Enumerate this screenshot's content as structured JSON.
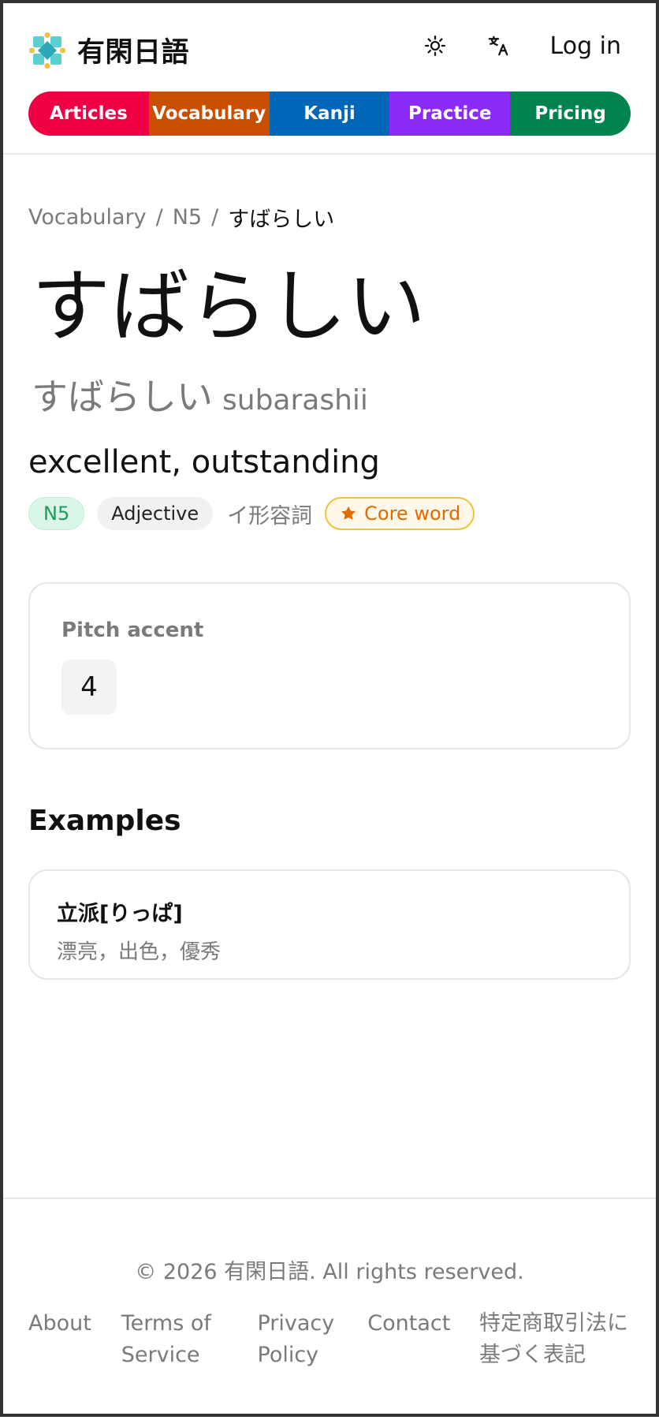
{
  "brand": {
    "title": "有閑日語",
    "logo_icon": "diamond-cluster-logo-icon"
  },
  "header": {
    "theme_toggle_icon": "sun-icon",
    "language_icon": "translate-icon",
    "login_label": "Log in"
  },
  "nav": {
    "items": [
      {
        "label": "Articles",
        "color": "#EF0044"
      },
      {
        "label": "Vocabulary",
        "color": "#C84F00"
      },
      {
        "label": "Kanji",
        "color": "#0067B8"
      },
      {
        "label": "Practice",
        "color": "#8A2BF7"
      },
      {
        "label": "Pricing",
        "color": "#00824E"
      }
    ]
  },
  "breadcrumb": {
    "items": [
      "Vocabulary",
      "N5",
      "すばらしい"
    ],
    "separator": "/"
  },
  "word": {
    "headword": "すばらしい",
    "reading_kana": "すばらしい",
    "reading_romaji": "subarashii",
    "meaning": "excellent, outstanding",
    "level": "N5",
    "part_of_speech": "Adjective",
    "part_of_speech_jp": "イ形容詞",
    "core_label": "Core word",
    "core_icon": "star-icon"
  },
  "pitch": {
    "label": "Pitch accent",
    "value": "4"
  },
  "examples": {
    "heading": "Examples",
    "items": [
      {
        "japanese": "立派[りっぱ]",
        "translation": "漂亮，出色，優秀"
      }
    ]
  },
  "footer": {
    "copyright": "© 2026 有閑日語. All rights reserved.",
    "links": [
      "About",
      "Terms of Service",
      "Privacy Policy",
      "Contact",
      "特定商取引法に基づく表記"
    ]
  },
  "colors": {
    "level_badge_bg": "#D9F6E8",
    "level_badge_text": "#1F9A59",
    "core_badge_border": "#F0C23A",
    "core_badge_text": "#E06B00"
  }
}
